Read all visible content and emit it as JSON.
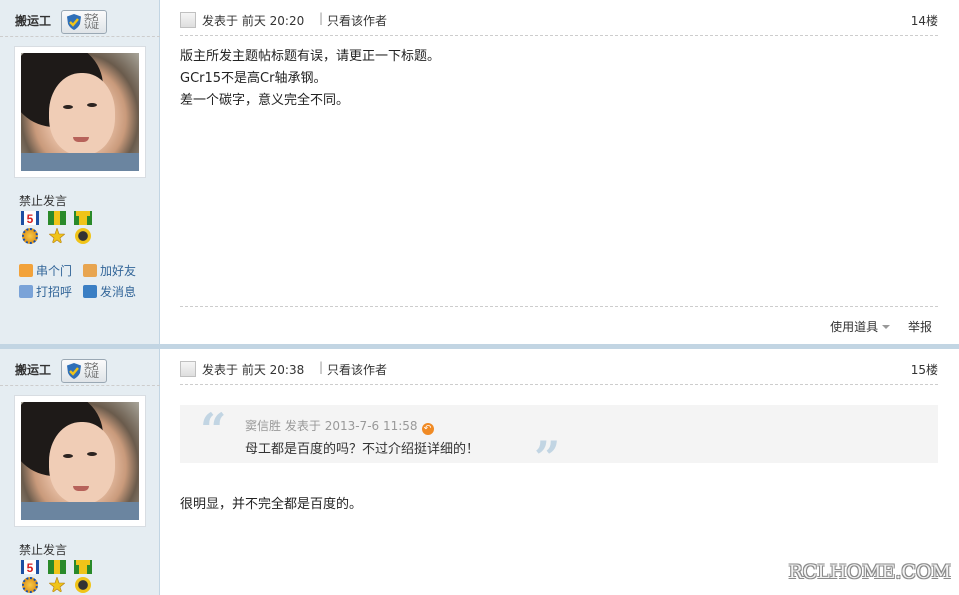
{
  "posts": [
    {
      "username": "搬运工",
      "verify_badge": "实名认证",
      "status": "禁止发言",
      "user_links": [
        "串个门",
        "加好友",
        "打招呼",
        "发消息"
      ],
      "posted_label": "发表于",
      "posted_time": "前天 20:20",
      "only_author": "只看该作者",
      "floor": "14楼",
      "content": [
        "版主所发主题帖标题有误，请更正一下标题。",
        "GCr15不是高Cr轴承钢。",
        "差一个碳字，意义完全不同。"
      ],
      "actions": {
        "tools": "使用道具",
        "report": "举报"
      }
    },
    {
      "username": "搬运工",
      "verify_badge": "实名认证",
      "status": "禁止发言",
      "posted_label": "发表于",
      "posted_time": "前天 20:38",
      "only_author": "只看该作者",
      "floor": "15楼",
      "quote": {
        "author": "窦信胜",
        "posted_label": "发表于",
        "time": "2013-7-6 11:58",
        "text": "母工都是百度的吗？不过介绍挺详细的！"
      },
      "content": "很明显，并不完全都是百度的。"
    }
  ],
  "watermark": "RCLHOME.COM",
  "colors": {
    "sidebar_bg": "#e5edf2",
    "link": "#336699",
    "separator": "#c2d5e3"
  },
  "icons": {
    "medals": [
      "medal-5-icon",
      "medal-star-icon",
      "medal-clock-icon"
    ],
    "links": [
      "home-icon",
      "handshake-icon",
      "wave-icon",
      "mail-icon"
    ]
  }
}
